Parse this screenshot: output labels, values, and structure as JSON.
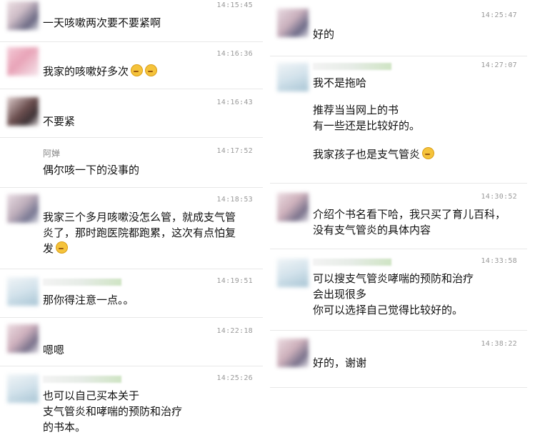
{
  "left": [
    {
      "name": "",
      "time": "14:15:45",
      "lines": [
        "一天咳嗽两次要不要紧啊"
      ]
    },
    {
      "name": "",
      "time": "14:16:36",
      "lines": [
        "我家的咳嗽好多次"
      ],
      "emoji": [
        "woozy-face-icon",
        "woozy-face-icon"
      ]
    },
    {
      "name": "",
      "time": "14:16:43",
      "lines": [
        "不要紧"
      ]
    },
    {
      "name": "阿婵",
      "time": "14:17:52",
      "lines": [
        "偶尔咳一下的没事的"
      ]
    },
    {
      "name": "",
      "time": "14:18:53",
      "lines": [
        "我家三个多月咳嗽没怎么管，就成支气管",
        "炎了，那时跑医院都跑累，这次有点怕复",
        "发"
      ],
      "emoji": [
        "tired-face-icon"
      ]
    },
    {
      "name": "",
      "time": "14:19:51",
      "lines": [
        "那你得注意一点。。"
      ]
    },
    {
      "name": "",
      "time": "14:22:18",
      "lines": [
        "嗯嗯"
      ]
    },
    {
      "name": "",
      "time": "14:25:26",
      "lines": [
        "也可以自己买本关于",
        "支气管炎和哮喘的预防和治疗",
        "的书本。"
      ]
    }
  ],
  "right": [
    {
      "name": "",
      "time": "14:25:47",
      "lines": [
        "好的"
      ]
    },
    {
      "name": "",
      "time": "14:27:07",
      "lines": [
        "我不是拖哈",
        "推荐当当网上的书",
        "有一些还是比较好的。",
        "我家孩子也是支气管炎"
      ],
      "emoji": [
        "tired-face-icon"
      ]
    },
    {
      "name": "",
      "time": "14:30:52",
      "lines": [
        "介绍个书名看下哈，我只买了育儿百科，",
        "没有支气管炎的具体内容"
      ]
    },
    {
      "name": "",
      "time": "14:33:58",
      "lines": [
        "可以搜支气管炎哮喘的预防和治疗",
        "会出现很多",
        "你可以选择自己觉得比较好的。"
      ]
    },
    {
      "name": "",
      "time": "14:38:22",
      "lines": [
        "好的，谢谢"
      ]
    }
  ]
}
